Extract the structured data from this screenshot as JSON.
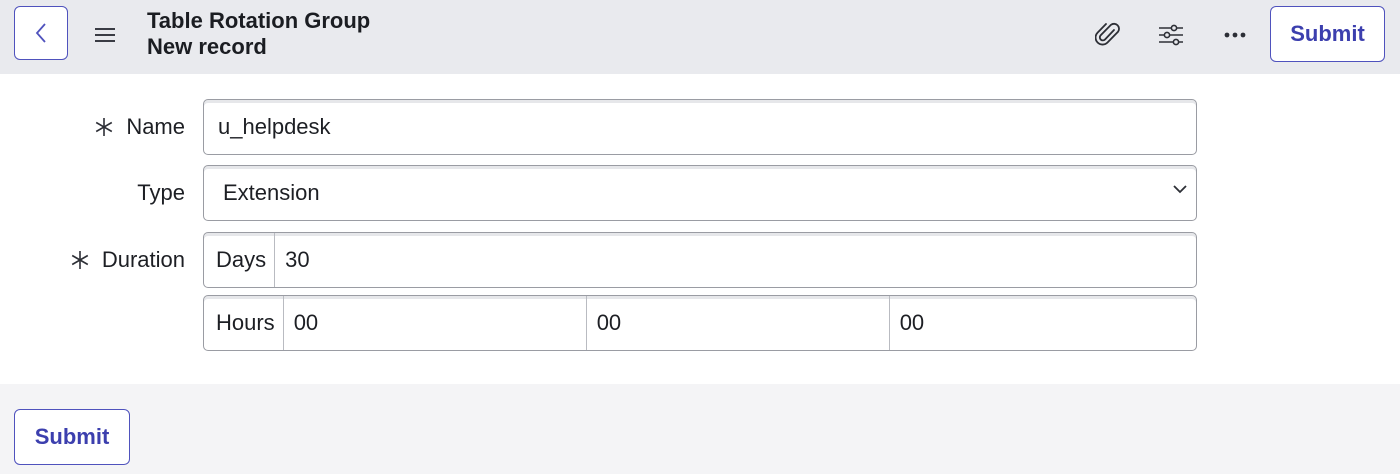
{
  "header": {
    "title": "Table Rotation Group",
    "subtitle": "New record",
    "back_icon": "chevron-left-icon",
    "menu_icon": "hamburger-menu-icon",
    "attach_icon": "paperclip-icon",
    "personalize_icon": "sliders-icon",
    "more_icon": "more-options-icon",
    "submit_label": "Submit"
  },
  "form": {
    "name": {
      "label": "Name",
      "required": true,
      "value": "u_helpdesk"
    },
    "type": {
      "label": "Type",
      "value": "Extension"
    },
    "duration": {
      "label": "Duration",
      "required": true,
      "days_label": "Days",
      "days_value": "30",
      "hours_label": "Hours",
      "hours_value": "00",
      "minutes_value": "00",
      "seconds_value": "00"
    }
  },
  "footer": {
    "submit_label": "Submit"
  },
  "colors": {
    "accent": "#4f52bd",
    "header_bg": "#e9eaee",
    "page_bg": "#f4f4f6"
  }
}
